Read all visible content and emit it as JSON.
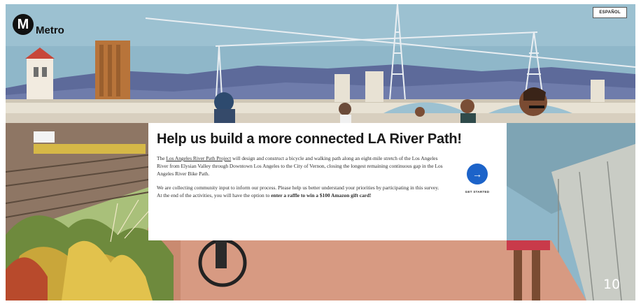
{
  "brand": {
    "mark": "M",
    "name": "Metro"
  },
  "header": {
    "language_button": "ESPAÑOL"
  },
  "card": {
    "title": "Help us build a more connected LA River Path!",
    "p1_link": "Los Angeles River Path Project",
    "p1_rest": " will design and construct a bicycle and walking path along an eight-mile stretch of the Los Angeles River from Elysian Valley through Downtown Los Angeles to the City of Vernon, closing the longest remaining continuous gap in the Los Angeles River Bike Path.",
    "p1_prefix": "The ",
    "p2_text": "We are collecting community input to inform our process. Please help us better understand your priorities by participating in this survey. At the end of the activities, you will have the option to ",
    "p2_bold": "enter a raffle to win a $100 Amazon gift card!",
    "cta_label": "GET STARTED",
    "cta_arrow": "→"
  },
  "slide_number": "10",
  "colors": {
    "sky": "#8fb7c9",
    "accent": "#1c63c9",
    "path": "#d79a82"
  }
}
